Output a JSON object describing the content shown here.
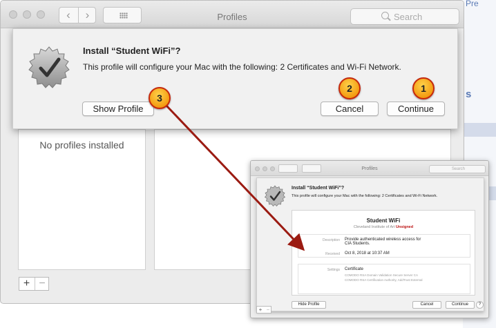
{
  "background": {
    "top_link_fragment": "Pre",
    "side_fragment": "s"
  },
  "window": {
    "title": "Profiles",
    "back_glyph": "‹",
    "forward_glyph": "›",
    "search_placeholder": "Search"
  },
  "sheet": {
    "title": "Install “Student WiFi”?",
    "message": "This profile will configure your Mac with the following: 2 Certificates and Wi-Fi Network.",
    "show_profile_label": "Show Profile",
    "cancel_label": "Cancel",
    "continue_label": "Continue"
  },
  "profiles_list": {
    "empty_text": "No profiles installed",
    "add_label": "+",
    "remove_label": "−"
  },
  "callouts": {
    "one": "1",
    "two": "2",
    "three": "3"
  },
  "inset": {
    "window_title": "Profiles",
    "search_placeholder": "Search",
    "sheet_title": "Install “Student WiFi”?",
    "sheet_message": "This profile will configure your Mac with the following: 2 Certificates and Wi-Fi Network.",
    "profile_name": "Student WiFi",
    "organization": "Cleveland Institute of Art",
    "signed_status": "Unsigned",
    "description_label": "Description",
    "description_value": "Provide authenticated wireless access for CIA Students.",
    "received_label": "Received",
    "received_value": "Oct 8, 2018 at 10:37 AM",
    "settings_label": "Settings",
    "settings_value": "Certificate",
    "settings_sub1": "COMODO RSA Domain Validation Secure Server CA",
    "settings_sub2": "COMODO RSA Certification Authority, AddTrust External",
    "hide_profile_label": "Hide Profile",
    "cancel_label": "Cancel",
    "continue_label": "Continue",
    "help_label": "?",
    "add_label": "+",
    "remove_label": "−"
  },
  "colors": {
    "callout_fill": "#f39c12",
    "callout_border": "#c6280c",
    "arrow": "#9b1b12",
    "unsigned": "#b11111"
  }
}
